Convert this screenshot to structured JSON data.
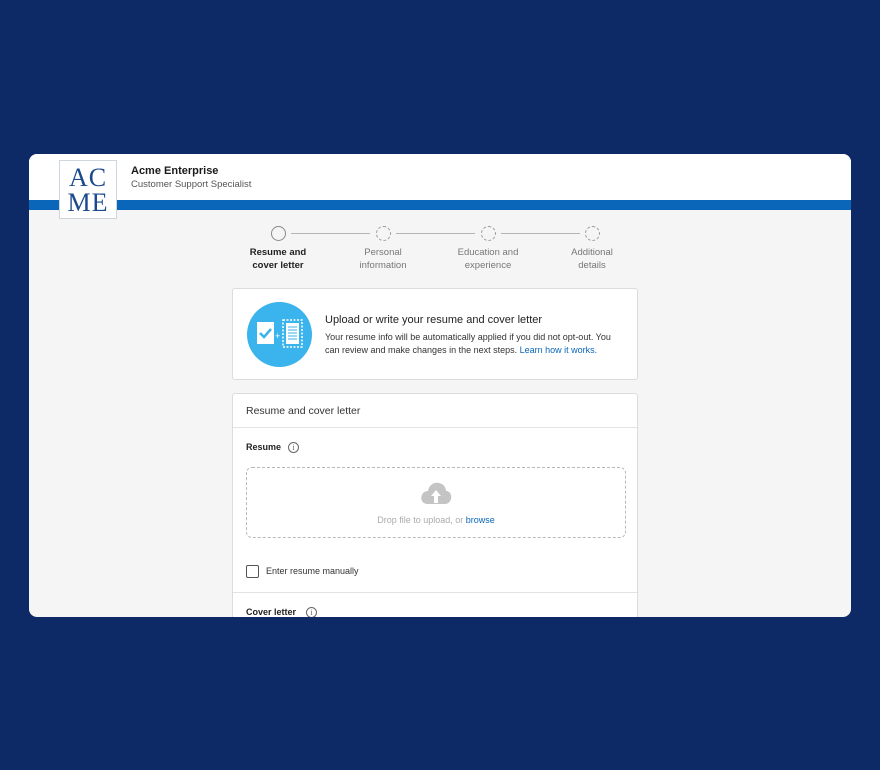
{
  "header": {
    "logo_line1": "AC",
    "logo_line2": "ME",
    "company": "Acme Enterprise",
    "job_title": "Customer Support Specialist"
  },
  "stepper": [
    {
      "line1": "Resume and",
      "line2": "cover letter",
      "active": true
    },
    {
      "line1": "Personal",
      "line2": "information",
      "active": false
    },
    {
      "line1": "Education and",
      "line2": "experience",
      "active": false
    },
    {
      "line1": "Additional",
      "line2": "details",
      "active": false
    }
  ],
  "intro": {
    "title": "Upload or write your resume and cover letter",
    "text": "Your resume info will be automatically applied if you did not opt-out. You can review and make changes in the next steps.",
    "link": "Learn how it works."
  },
  "form": {
    "section_title": "Resume and cover letter",
    "resume_label": "Resume",
    "drop_text": "Drop file to upload, or",
    "browse": "browse",
    "manual_label": "Enter resume manually",
    "cover_label": "Cover letter"
  },
  "icons": {
    "info": "info-icon",
    "upload": "cloud-upload-icon",
    "document": "document-check-icon"
  },
  "colors": {
    "background": "#0e2a66",
    "accent": "#0a66b8",
    "icon_circle": "#3bb3ec"
  }
}
